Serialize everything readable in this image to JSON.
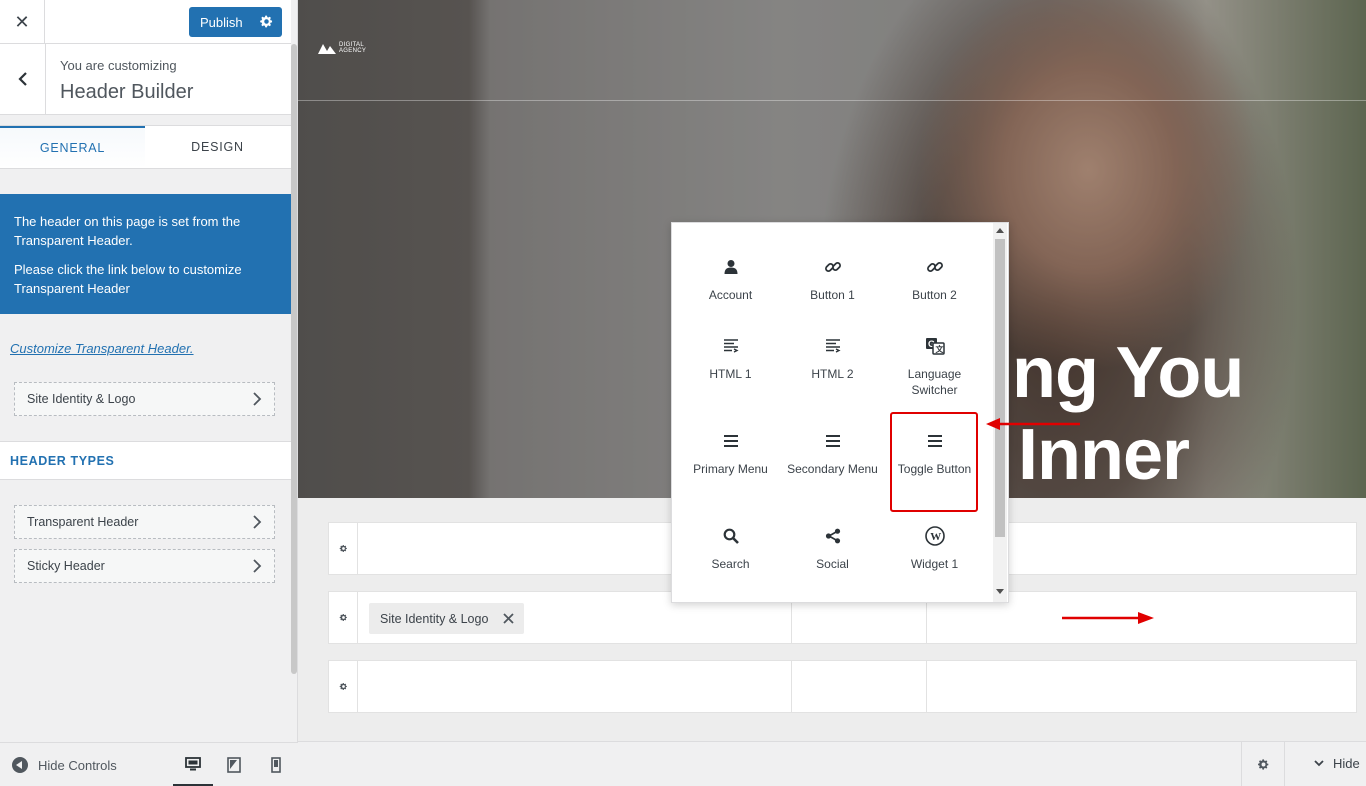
{
  "sidebar": {
    "close_label": "✕",
    "publish_label": "Publish",
    "customizing_label": "You are customizing",
    "customizing_title": "Header Builder",
    "tabs": [
      {
        "label": "GENERAL",
        "active": true
      },
      {
        "label": "DESIGN",
        "active": false
      }
    ],
    "notice": {
      "line1": "The header on this page is set from the Transparent Header.",
      "line2": "Please click the link below to customize Transparent Header"
    },
    "customize_link": "Customize Transparent Header.",
    "site_identity": "Site Identity & Logo",
    "section_title": "HEADER TYPES",
    "header_types": [
      "Transparent Header",
      "Sticky Header"
    ],
    "footer": {
      "hide_controls": "Hide Controls",
      "devices": [
        "desktop",
        "tablet",
        "mobile"
      ],
      "active_device": "desktop"
    }
  },
  "preview": {
    "logo_line1": "DIGITAL",
    "logo_line2": "AGENCY",
    "hero_line1": "ng You",
    "hero_line2": "Inner"
  },
  "builder": {
    "rows": [
      {
        "name": "top"
      },
      {
        "name": "main",
        "chip": "Site Identity & Logo"
      },
      {
        "name": "bottom"
      }
    ]
  },
  "popup": {
    "items": [
      {
        "label": "Account",
        "icon": "user-icon"
      },
      {
        "label": "Button 1",
        "icon": "link-icon"
      },
      {
        "label": "Button 2",
        "icon": "link-icon"
      },
      {
        "label": "HTML 1",
        "icon": "text-lines-icon"
      },
      {
        "label": "HTML 2",
        "icon": "text-lines-icon"
      },
      {
        "label": "Language Switcher",
        "icon": "translate-icon"
      },
      {
        "label": "Primary Menu",
        "icon": "menu-icon"
      },
      {
        "label": "Secondary Menu",
        "icon": "menu-icon"
      },
      {
        "label": "Toggle Button",
        "icon": "menu-icon",
        "highlighted": true
      },
      {
        "label": "Search",
        "icon": "search-icon"
      },
      {
        "label": "Social",
        "icon": "share-icon"
      },
      {
        "label": "Widget 1",
        "icon": "wordpress-icon"
      }
    ]
  },
  "bottom_bar": {
    "hide_label": "Hide"
  },
  "colors": {
    "accent": "#2271b1",
    "annotation": "#e00000"
  }
}
